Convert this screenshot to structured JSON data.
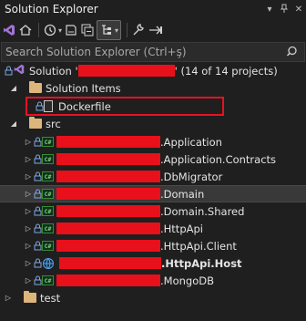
{
  "window": {
    "title": "Solution Explorer"
  },
  "search": {
    "placeholder": "Search Solution Explorer (Ctrl+ş)"
  },
  "tree": {
    "solution": {
      "prefix": "Solution '",
      "suffix": "' (14 of 14 projects)"
    },
    "solution_items": "Solution Items",
    "dockerfile": "Dockerfile",
    "src": "src",
    "projects": [
      {
        "suffix": ".Application",
        "bold": false
      },
      {
        "suffix": ".Application.Contracts",
        "bold": false
      },
      {
        "suffix": ".DbMigrator",
        "bold": false
      },
      {
        "suffix": ".Domain",
        "bold": false,
        "selected": true
      },
      {
        "suffix": ".Domain.Shared",
        "bold": false
      },
      {
        "suffix": ".HttpApi",
        "bold": false
      },
      {
        "suffix": ".HttpApi.Client",
        "bold": false
      },
      {
        "suffix": ".HttpApi.Host",
        "bold": true
      },
      {
        "suffix": ".MongoDB",
        "bold": false
      }
    ],
    "test": "test"
  },
  "colors": {
    "highlight_box": "#e81123",
    "redaction": "#e8101a",
    "folder": "#dcb67a",
    "csharp": "#388a34"
  },
  "icons": [
    "vs-solution-icon",
    "home-icon",
    "sync-icon",
    "history-icon",
    "collapse-all-icon",
    "show-all-files-icon",
    "properties-icon",
    "preview-icon",
    "search-icon",
    "lock-icon",
    "folder-icon",
    "file-icon",
    "csharp-project-icon",
    "globe-icon"
  ]
}
